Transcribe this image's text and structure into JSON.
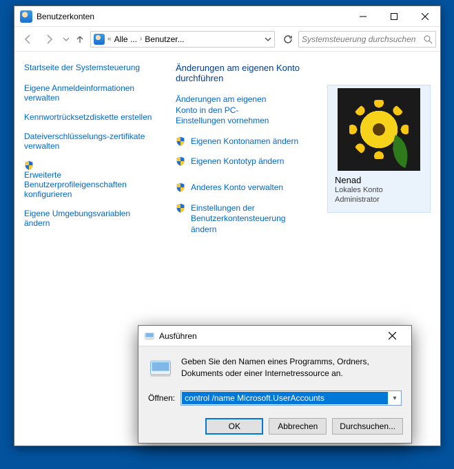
{
  "window": {
    "title": "Benutzerkonten",
    "breadcrumb": {
      "part1": "Alle ...",
      "part2": "Benutzer..."
    },
    "search_placeholder": "Systemsteuerung durchsuchen"
  },
  "sidebar": {
    "home": "Startseite der Systemsteuerung",
    "items": [
      {
        "label": "Eigene Anmeldeinformationen verwalten",
        "shield": false
      },
      {
        "label": "Kennwortrücksetzdiskette erstellen",
        "shield": false
      },
      {
        "label": "Dateiverschlüsselungs-zertifikate verwalten",
        "shield": false
      },
      {
        "label": "Erweiterte Benutzerprofileigenschaften konfigurieren",
        "shield": true
      },
      {
        "label": "Eigene Umgebungsvariablen ändern",
        "shield": false
      }
    ]
  },
  "main": {
    "heading": "Änderungen am eigenen Konto durchführen",
    "actions": [
      {
        "label": "Änderungen am eigenen Konto in den PC-Einstellungen vornehmen",
        "shield": false
      },
      {
        "label": "Eigenen Kontonamen ändern",
        "shield": true
      },
      {
        "label": "Eigenen Kontotyp ändern",
        "shield": true
      },
      {
        "label": "Anderes Konto verwalten",
        "shield": true
      },
      {
        "label": "Einstellungen der Benutzerkontensteuerung ändern",
        "shield": true
      }
    ],
    "user": {
      "name": "Nenad",
      "type": "Lokales Konto",
      "role": "Administrator"
    }
  },
  "run": {
    "title": "Ausführen",
    "hint": "Geben Sie den Namen eines Programms, Ordners, Dokuments oder einer Internetressource an.",
    "open_label": "Öffnen:",
    "value": "control /name Microsoft.UserAccounts",
    "ok": "OK",
    "cancel": "Abbrechen",
    "browse": "Durchsuchen..."
  }
}
